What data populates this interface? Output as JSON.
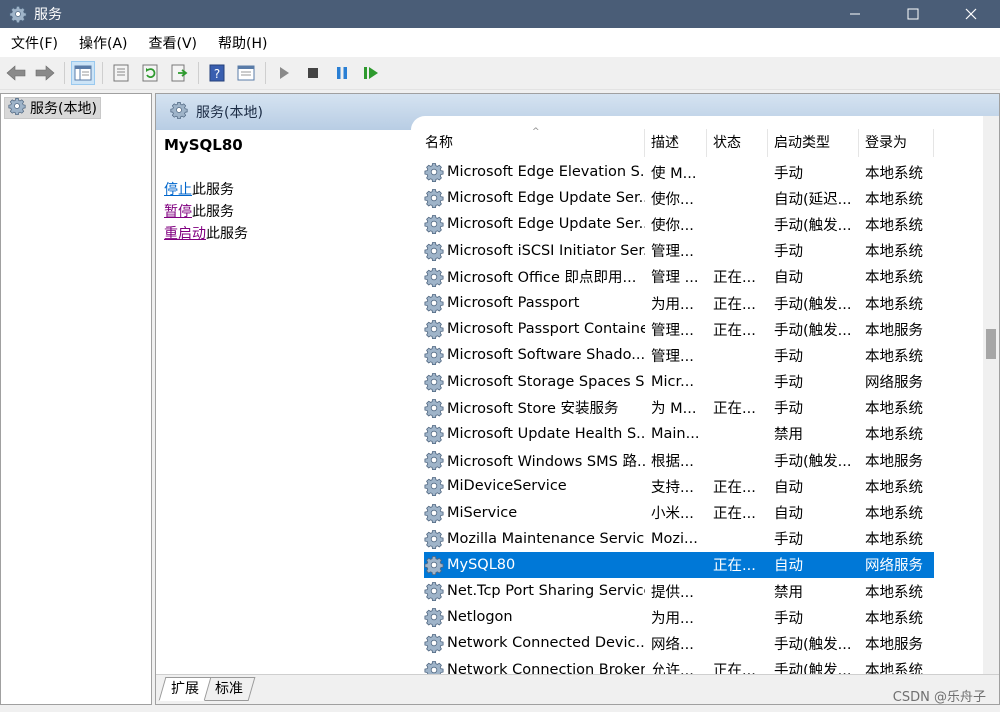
{
  "window": {
    "title": "服务",
    "icon": "gear-icon",
    "controls": [
      "minimize-icon",
      "maximize-icon",
      "close-icon"
    ]
  },
  "menu": [
    "文件(F)",
    "操作(A)",
    "查看(V)",
    "帮助(H)"
  ],
  "toolbar_icons": [
    "back-arrow-icon",
    "forward-arrow-icon",
    "show-tree-icon",
    "properties-icon",
    "refresh-icon",
    "export-icon",
    "help-icon",
    "console-icon",
    "start-icon",
    "stop-icon",
    "pause-icon",
    "restart-icon"
  ],
  "tree": {
    "item_label": "服务(本地)"
  },
  "main": {
    "header_label": "服务(本地)",
    "selected_service": "MySQL80",
    "actions": [
      {
        "link": "停止",
        "suffix": "此服务"
      },
      {
        "link": "暂停",
        "suffix": "此服务"
      },
      {
        "link": "重启动",
        "suffix": "此服务"
      }
    ]
  },
  "list": {
    "columns": [
      "名称",
      "描述",
      "状态",
      "启动类型",
      "登录为"
    ],
    "sort_indicator": "^",
    "rows": [
      [
        "Microsoft Edge Elevation S...",
        "使 M...",
        "",
        "手动",
        "本地系统"
      ],
      [
        "Microsoft Edge Update Ser...",
        "使你...",
        "",
        "自动(延迟...",
        "本地系统"
      ],
      [
        "Microsoft Edge Update Ser...",
        "使你...",
        "",
        "手动(触发...",
        "本地系统"
      ],
      [
        "Microsoft iSCSI Initiator Ser...",
        "管理...",
        "",
        "手动",
        "本地系统"
      ],
      [
        "Microsoft Office 即点即用...",
        "管理 ...",
        "正在...",
        "自动",
        "本地系统"
      ],
      [
        "Microsoft Passport",
        "为用...",
        "正在...",
        "手动(触发...",
        "本地系统"
      ],
      [
        "Microsoft Passport Container",
        "管理...",
        "正在...",
        "手动(触发...",
        "本地服务"
      ],
      [
        "Microsoft Software Shado...",
        "管理...",
        "",
        "手动",
        "本地系统"
      ],
      [
        "Microsoft Storage Spaces S...",
        "Micr...",
        "",
        "手动",
        "网络服务"
      ],
      [
        "Microsoft Store 安装服务",
        "为 M...",
        "正在...",
        "手动",
        "本地系统"
      ],
      [
        "Microsoft Update Health S...",
        "Main...",
        "",
        "禁用",
        "本地系统"
      ],
      [
        "Microsoft Windows SMS 路...",
        "根据...",
        "",
        "手动(触发...",
        "本地服务"
      ],
      [
        "MiDeviceService",
        "支持...",
        "正在...",
        "自动",
        "本地系统"
      ],
      [
        "MiService",
        "小米...",
        "正在...",
        "自动",
        "本地系统"
      ],
      [
        "Mozilla Maintenance Service",
        "Mozi...",
        "",
        "手动",
        "本地系统"
      ],
      [
        "MySQL80",
        "",
        "正在...",
        "自动",
        "网络服务"
      ],
      [
        "Net.Tcp Port Sharing Service",
        "提供...",
        "",
        "禁用",
        "本地系统"
      ],
      [
        "Netlogon",
        "为用...",
        "",
        "手动",
        "本地系统"
      ],
      [
        "Network Connected Devic...",
        "网络...",
        "",
        "手动(触发...",
        "本地服务"
      ],
      [
        "Network Connection Broker",
        "允许...",
        "正在...",
        "手动(触发...",
        "本地系统"
      ]
    ],
    "selected_index": 15
  },
  "tabs": [
    "扩展",
    "标准"
  ],
  "watermark": "CSDN @乐舟子",
  "colors": {
    "titlebar": "#4a5d77",
    "selection": "#0078d7",
    "link": "#0066cc",
    "visited_link": "#800080"
  }
}
